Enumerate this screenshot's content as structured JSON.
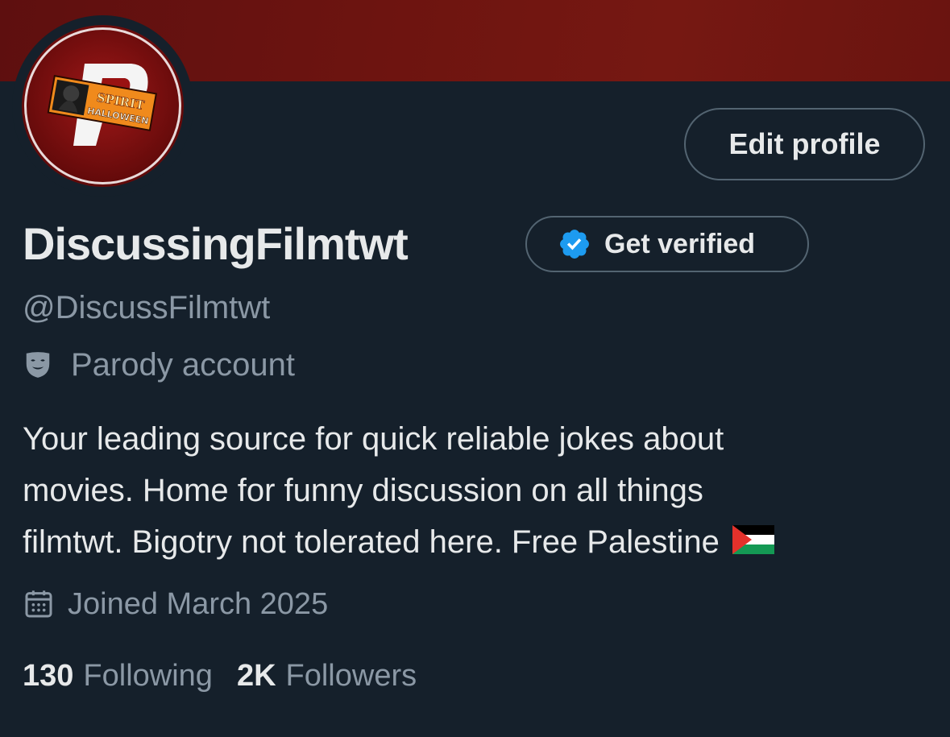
{
  "profile": {
    "display_name": "DiscussingFilmtwt",
    "handle": "@DiscussFilmtwt",
    "parody_label": "Parody account",
    "bio_lines": [
      "Your leading source for quick reliable jokes about",
      "movies. Home for funny discussion on all things",
      "filmtwt. Bigotry not tolerated here. Free Palestine"
    ],
    "joined": "Joined March 2025"
  },
  "avatar": {
    "logo_line1": "SPIRIT",
    "logo_line2": "HALLOWEEN"
  },
  "buttons": {
    "edit_profile": "Edit profile",
    "get_verified": "Get verified"
  },
  "stats": {
    "following_count": "130",
    "following_label": "Following",
    "followers_count": "2K",
    "followers_label": "Followers"
  },
  "icons": {
    "verified_badge": "verified-badge-icon",
    "parody": "theater-mask-icon",
    "calendar": "calendar-icon",
    "flag": "palestine-flag-icon"
  },
  "colors": {
    "background": "#15202b",
    "banner": "#6d1410",
    "text_primary": "#e7e9ea",
    "text_secondary": "#8b98a5",
    "border": "#536471",
    "verified_blue": "#1d9bf0"
  }
}
